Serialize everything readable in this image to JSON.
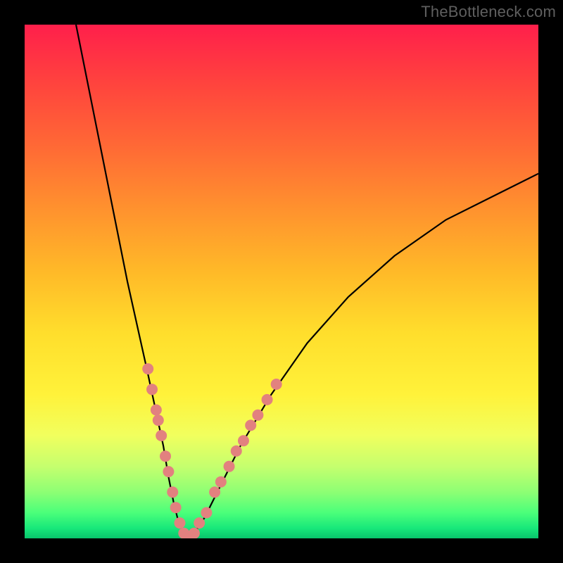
{
  "watermark": "TheBottleneck.com",
  "chart_data": {
    "type": "line",
    "title": "",
    "xlabel": "",
    "ylabel": "",
    "xlim": [
      0,
      100
    ],
    "ylim": [
      0,
      100
    ],
    "series": [
      {
        "name": "curve",
        "x": [
          10,
          12,
          14,
          16,
          18,
          20,
          22,
          24,
          25.5,
          27,
          28,
          29,
          30,
          31,
          32,
          33,
          35,
          38,
          42,
          48,
          55,
          63,
          72,
          82,
          92,
          100
        ],
        "y": [
          100,
          90,
          80,
          70,
          60,
          50,
          41,
          32,
          25,
          18,
          12,
          7,
          3,
          1,
          0,
          1,
          4,
          10,
          18,
          28,
          38,
          47,
          55,
          62,
          67,
          71
        ]
      }
    ],
    "scatter_points": {
      "name": "markers",
      "color": "#e2817f",
      "points": [
        {
          "x": 24.0,
          "y": 33
        },
        {
          "x": 24.8,
          "y": 29
        },
        {
          "x": 25.6,
          "y": 25
        },
        {
          "x": 26.0,
          "y": 23
        },
        {
          "x": 26.6,
          "y": 20
        },
        {
          "x": 27.4,
          "y": 16
        },
        {
          "x": 28.0,
          "y": 13
        },
        {
          "x": 28.8,
          "y": 9
        },
        {
          "x": 29.4,
          "y": 6
        },
        {
          "x": 30.2,
          "y": 3
        },
        {
          "x": 31.0,
          "y": 1
        },
        {
          "x": 32.0,
          "y": 0
        },
        {
          "x": 33.0,
          "y": 1
        },
        {
          "x": 34.0,
          "y": 3
        },
        {
          "x": 35.4,
          "y": 5
        },
        {
          "x": 37.0,
          "y": 9
        },
        {
          "x": 38.2,
          "y": 11
        },
        {
          "x": 39.8,
          "y": 14
        },
        {
          "x": 41.2,
          "y": 17
        },
        {
          "x": 42.6,
          "y": 19
        },
        {
          "x": 44.0,
          "y": 22
        },
        {
          "x": 45.4,
          "y": 24
        },
        {
          "x": 47.2,
          "y": 27
        },
        {
          "x": 49.0,
          "y": 30
        }
      ]
    }
  }
}
